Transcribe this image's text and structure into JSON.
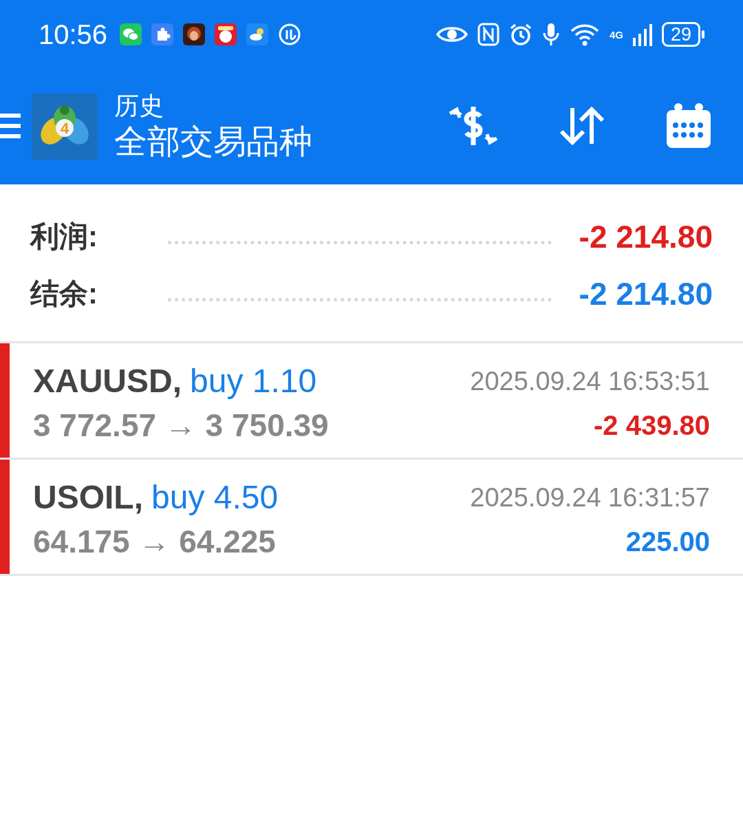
{
  "status_bar": {
    "time": "10:56",
    "network": "4G",
    "battery": "29"
  },
  "app_bar": {
    "logo_mark": "4",
    "subtitle": "历史",
    "title": "全部交易品种"
  },
  "summary": [
    {
      "label": "利润:",
      "value": "-2 214.80",
      "color": "#e0201e"
    },
    {
      "label": "结余:",
      "value": "-2 214.80",
      "color": "#1a7fe8"
    }
  ],
  "trades": [
    {
      "symbol": "XAUUSD,",
      "side": "buy 1.10",
      "prices": "3 772.57 → 3 750.39",
      "time": "2025.09.24 16:53:51",
      "profit": "-2 439.80",
      "color": "#e0201e"
    },
    {
      "symbol": "USOIL,",
      "side": "buy 4.50",
      "prices": "64.175 → 64.225",
      "time": "2025.09.24 16:31:57",
      "profit": "225.00",
      "color": "#1a7fe8"
    }
  ]
}
